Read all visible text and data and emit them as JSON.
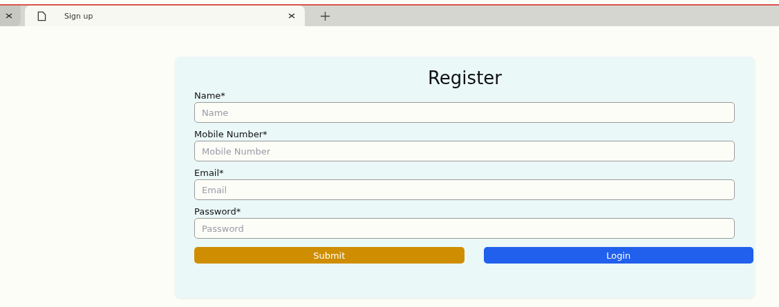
{
  "browser": {
    "tabs": [
      {
        "selected": false
      },
      {
        "label": "Sign up",
        "selected": true
      }
    ]
  },
  "form": {
    "title": "Register",
    "fields": [
      {
        "label": "Name*",
        "placeholder": "Name"
      },
      {
        "label": "Mobile Number*",
        "placeholder": "Mobile Number"
      },
      {
        "label": "Email*",
        "placeholder": "Email"
      },
      {
        "label": "Password*",
        "placeholder": "Password"
      }
    ],
    "buttons": [
      {
        "label": "Submit",
        "kind": "submit"
      },
      {
        "label": "Login",
        "kind": "login"
      }
    ]
  }
}
